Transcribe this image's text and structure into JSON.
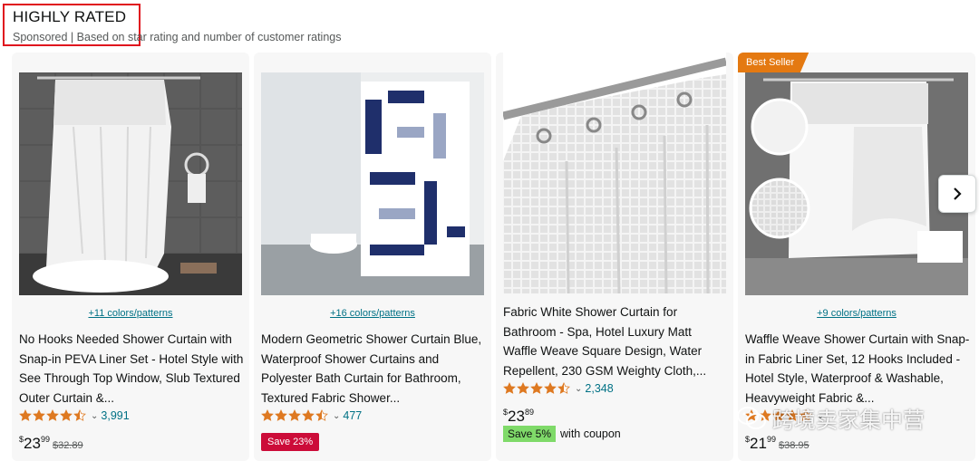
{
  "header": {
    "title": "HIGHLY RATED",
    "subtitle": "Sponsored | Based on star rating and number of customer ratings"
  },
  "products": [
    {
      "variants": "+11 colors/patterns",
      "title": "No Hooks Needed Shower Curtain with Snap-in PEVA Liner Set - Hotel Style with See Through Top Window, Slub Textured Outer Curtain &...",
      "rating": 4.5,
      "rating_count": "3,991",
      "price_currency": "$",
      "price_whole": "23",
      "price_fraction": "99",
      "list_price": "$32.89"
    },
    {
      "variants": "+16 colors/patterns",
      "title": "Modern Geometric Shower Curtain Blue, Waterproof Shower Curtains and Polyester Bath Curtain for Bathroom, Textured Fabric Shower...",
      "rating": 4.5,
      "rating_count": "477",
      "save_badge": "Save 23%"
    },
    {
      "title": "Fabric White Shower Curtain for Bathroom - Spa, Hotel Luxury Matt Waffle Weave Square Design, Water Repellent, 230 GSM Weighty Cloth,...",
      "rating": 4.5,
      "rating_count": "2,348",
      "price_currency": "$",
      "price_whole": "23",
      "price_fraction": "89",
      "coupon_badge": "Save 5%",
      "coupon_text": "with coupon"
    },
    {
      "badge": "Best Seller",
      "variants": "+9 colors/patterns",
      "title": "Waffle Weave Shower Curtain with Snap-in Fabric Liner Set, 12 Hooks Included - Hotel Style, Waterproof & Washable, Heavyweight Fabric &...",
      "rating": 4.5,
      "price_currency": "$",
      "price_whole": "21",
      "price_fraction": "99",
      "list_price": "$38.95"
    }
  ],
  "watermark": "跨境卖家集中营",
  "colors": {
    "star": "#de7921",
    "link": "#007185",
    "deal": "#cc0c39",
    "coupon": "#7fda69",
    "best_seller": "#e47911"
  },
  "icons": {
    "next": "chevron-right-icon",
    "watermark": "wechat-icon"
  }
}
